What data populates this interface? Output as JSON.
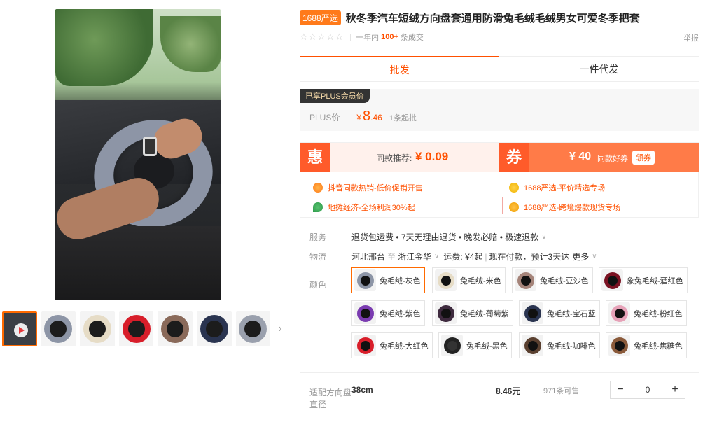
{
  "product": {
    "badge": "1688严选",
    "title": "秋冬季汽车短绒方向盘套通用防滑兔毛绒毛绒男女可爱冬季把套",
    "rating": {
      "stars": "☆☆☆☆☆",
      "period": "一年内",
      "sold": "100+",
      "unit": "条成交"
    },
    "report": "举报"
  },
  "tabs": [
    {
      "label": "批发"
    },
    {
      "label": "一件代发"
    }
  ],
  "plus": {
    "tag": "已享PLUS会员价",
    "label": "PLUS价",
    "currency": "¥",
    "price_int": "8",
    "price_dec": ".46",
    "moq": "1条起批"
  },
  "promo": {
    "hui": "惠",
    "rec_label": "同款推荐:",
    "rec_price": "¥ 0.09",
    "quan": "券",
    "coupon_amount": "¥ 40",
    "coupon_label": "同款好券",
    "coupon_button": "领券",
    "tags": [
      {
        "text": "抖音同款热销-低价促销开售",
        "icon": "sun-icon",
        "color": "#ff7a1a"
      },
      {
        "text": "1688严选-平价精选专场",
        "icon": "flower-icon",
        "color": "#f0b400"
      },
      {
        "text": "地摊经济-全场利润30%起",
        "icon": "leaf-icon",
        "color": "#2e9b4b"
      },
      {
        "text": "1688严选-跨境爆款现货专场",
        "icon": "bear-icon",
        "color": "#f0a000"
      }
    ]
  },
  "specs": {
    "service_label": "服务",
    "service_value": "退货包运费 • 7天无理由退货 • 晚发必赔 • 极速退款",
    "logistics_label": "物流",
    "origin": "河北邢台",
    "to": "至",
    "dest": "浙江金华",
    "freight": "运费: ¥4起",
    "ship": "现在付款，预计3天达",
    "more": "更多",
    "color_label": "颜色"
  },
  "colors": [
    {
      "name": "兔毛绒-灰色",
      "swatch": "#8d95a6",
      "selected": true
    },
    {
      "name": "兔毛绒-米色",
      "swatch": "#e6dcc6",
      "selected": false
    },
    {
      "name": "兔毛绒-豆沙色",
      "swatch": "#a5847a",
      "selected": false
    },
    {
      "name": "象兔毛绒-酒红色",
      "swatch": "#7a1222",
      "selected": false
    },
    {
      "name": "兔毛绒-紫色",
      "swatch": "#7a3bb0",
      "selected": false
    },
    {
      "name": "兔毛绒-葡萄紫",
      "swatch": "#3e2a3e",
      "selected": false
    },
    {
      "name": "兔毛绒-宝石蓝",
      "swatch": "#2a3450",
      "selected": false
    },
    {
      "name": "兔毛绒-粉红色",
      "swatch": "#e6a2b8",
      "selected": false
    },
    {
      "name": "兔毛绒-大红色",
      "swatch": "#d81e2a",
      "selected": false
    },
    {
      "name": "兔毛绒-黑色",
      "swatch": "#222222",
      "selected": false
    },
    {
      "name": "兔毛绒-咖啡色",
      "swatch": "#5a4030",
      "selected": false
    },
    {
      "name": "兔毛绒-焦糖色",
      "swatch": "#8a5a3a",
      "selected": false
    }
  ],
  "order": {
    "size_label": "适配方向盘直径",
    "size_value": "38cm",
    "price": "8.46元",
    "stock": "971条可售",
    "minus": "−",
    "qty": "0",
    "plus": "+"
  },
  "thumbnails": [
    {
      "name": "video",
      "ring": "#999999"
    },
    {
      "name": "grey",
      "ring": "#8d95a6"
    },
    {
      "name": "beige",
      "ring": "#e6dcc6"
    },
    {
      "name": "red",
      "ring": "#d81e2a"
    },
    {
      "name": "brown",
      "ring": "#8a6a5a"
    },
    {
      "name": "blue",
      "ring": "#2a3450"
    },
    {
      "name": "grey2",
      "ring": "#9aa0ad"
    }
  ],
  "accent": "#ff5000"
}
